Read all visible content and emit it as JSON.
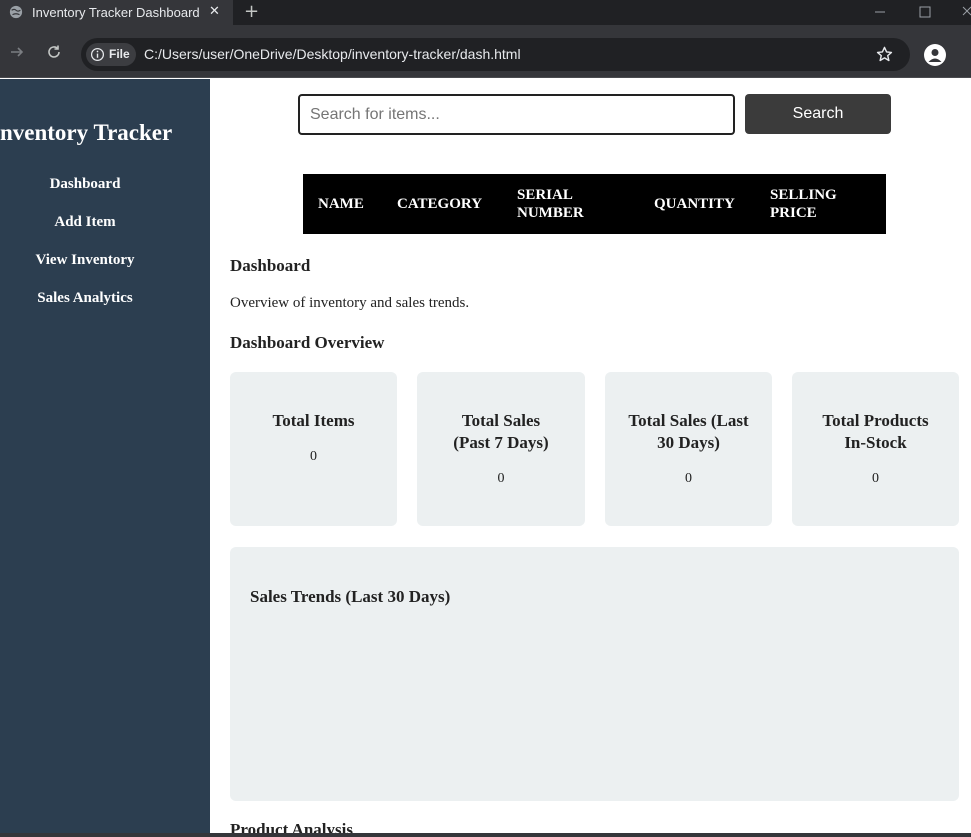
{
  "browser": {
    "tab_title": "Inventory Tracker Dashboard",
    "tab_close": "✕",
    "new_tab": "+",
    "chip_label": "File",
    "url": "C:/Users/user/OneDrive/Desktop/inventory-tracker/dash.html"
  },
  "sidebar": {
    "brand": "Inventory Tracker",
    "items": [
      {
        "label": "Dashboard"
      },
      {
        "label": "Add Item"
      },
      {
        "label": "View Inventory"
      },
      {
        "label": "Sales Analytics"
      }
    ]
  },
  "search": {
    "placeholder": "Search for items...",
    "button_label": "Search"
  },
  "table": {
    "headers": [
      "NAME",
      "CATEGORY",
      "SERIAL NUMBER",
      "QUANTITY",
      "SELLING PRICE"
    ]
  },
  "dashboard": {
    "heading": "Dashboard",
    "description": "Overview of inventory and sales trends.",
    "overview_heading": "Dashboard Overview",
    "cards": [
      {
        "title": "Total Items",
        "value": "0"
      },
      {
        "title": "Total Sales (Past 7 Days)",
        "value": "0"
      },
      {
        "title": "Total Sales (Last 30 Days)",
        "value": "0"
      },
      {
        "title": "Total Products In-Stock",
        "value": "0"
      }
    ],
    "trends_title": "Sales Trends (Last 30 Days)",
    "product_heading": "Product Analysis"
  },
  "colors": {
    "sidebar_bg": "#2c3e50",
    "card_bg": "#ecf0f1",
    "table_header_bg": "#000000",
    "search_button_bg": "#3b3b3b"
  }
}
